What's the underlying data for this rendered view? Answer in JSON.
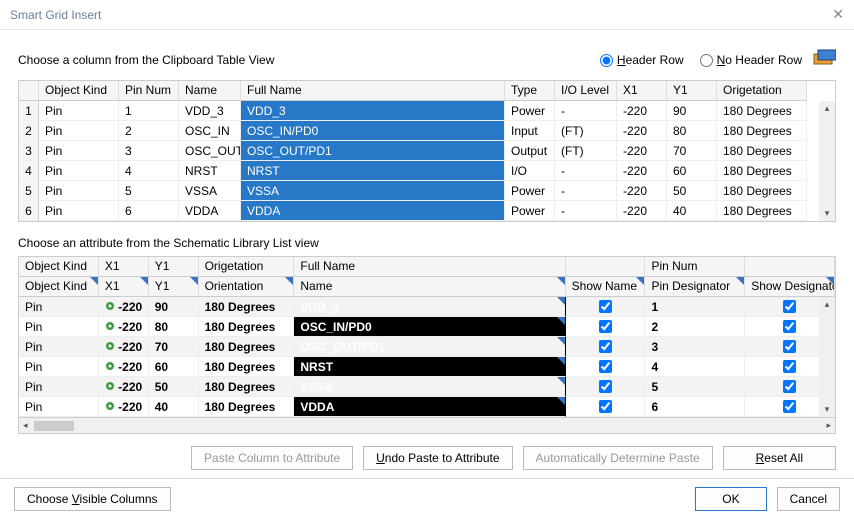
{
  "window": {
    "title": "Smart Grid Insert"
  },
  "top": {
    "prompt": "Choose a column from the Clipboard Table View",
    "header_row": "Header Row",
    "no_header_row": "No Header Row"
  },
  "grid1": {
    "headers": {
      "kind": "Object Kind",
      "pinnum": "Pin Num",
      "name": "Name",
      "fullname": "Full Name",
      "type": "Type",
      "io": "I/O Level",
      "x1": "X1",
      "y1": "Y1",
      "orig": "Origetation"
    },
    "rows": [
      {
        "n": "1",
        "kind": "Pin",
        "pin": "1",
        "name": "VDD_3",
        "full": "VDD_3",
        "type": "Power",
        "io": "-",
        "x1": "-220",
        "y1": "90",
        "orig": "180 Degrees"
      },
      {
        "n": "2",
        "kind": "Pin",
        "pin": "2",
        "name": "OSC_IN",
        "full": "OSC_IN/PD0",
        "type": "Input",
        "io": "(FT)",
        "x1": "-220",
        "y1": "80",
        "orig": "180 Degrees"
      },
      {
        "n": "3",
        "kind": "Pin",
        "pin": "3",
        "name": "OSC_OUT",
        "full": "OSC_OUT/PD1",
        "type": "Output",
        "io": "(FT)",
        "x1": "-220",
        "y1": "70",
        "orig": "180 Degrees"
      },
      {
        "n": "4",
        "kind": "Pin",
        "pin": "4",
        "name": "NRST",
        "full": "NRST",
        "type": "I/O",
        "io": "-",
        "x1": "-220",
        "y1": "60",
        "orig": "180 Degrees"
      },
      {
        "n": "5",
        "kind": "Pin",
        "pin": "5",
        "name": "VSSA",
        "full": "VSSA",
        "type": "Power",
        "io": "-",
        "x1": "-220",
        "y1": "50",
        "orig": "180 Degrees"
      },
      {
        "n": "6",
        "kind": "Pin",
        "pin": "6",
        "name": "VDDA",
        "full": "VDDA",
        "type": "Power",
        "io": "-",
        "x1": "-220",
        "y1": "40",
        "orig": "180 Degrees"
      }
    ]
  },
  "mid": {
    "prompt": "Choose an attribute from the Schematic Library List view"
  },
  "grid2": {
    "headers1": {
      "kind": "Object Kind",
      "x1": "X1",
      "y1": "Y1",
      "orig": "Origetation",
      "full": "Full Name",
      "pinnum": "Pin Num"
    },
    "headers2": {
      "kind": "Object Kind",
      "x1": "X1",
      "y1": "Y1",
      "orig": "Orientation",
      "name": "Name",
      "showname": "Show Name",
      "pindesig": "Pin Designator",
      "showdesig": "Show Designator"
    },
    "rows": [
      {
        "kind": "Pin",
        "x1": "-220",
        "y1": "90",
        "orig": "180 Degrees",
        "name": "VDD_3",
        "pd": "1"
      },
      {
        "kind": "Pin",
        "x1": "-220",
        "y1": "80",
        "orig": "180 Degrees",
        "name": "OSC_IN/PD0",
        "pd": "2"
      },
      {
        "kind": "Pin",
        "x1": "-220",
        "y1": "70",
        "orig": "180 Degrees",
        "name": "OSC_OUT/PD1",
        "pd": "3"
      },
      {
        "kind": "Pin",
        "x1": "-220",
        "y1": "60",
        "orig": "180 Degrees",
        "name": "NRST",
        "pd": "4"
      },
      {
        "kind": "Pin",
        "x1": "-220",
        "y1": "50",
        "orig": "180 Degrees",
        "name": "VSSA",
        "pd": "5"
      },
      {
        "kind": "Pin",
        "x1": "-220",
        "y1": "40",
        "orig": "180 Degrees",
        "name": "VDDA",
        "pd": "6"
      }
    ]
  },
  "buttons": {
    "paste_col": "Paste Column to Attribute",
    "undo_paste": "Undo Paste to Attribute",
    "auto_det": "Automatically Determine Paste",
    "reset": "Reset All",
    "visible": "Choose Visible Columns",
    "ok": "OK",
    "cancel": "Cancel"
  }
}
